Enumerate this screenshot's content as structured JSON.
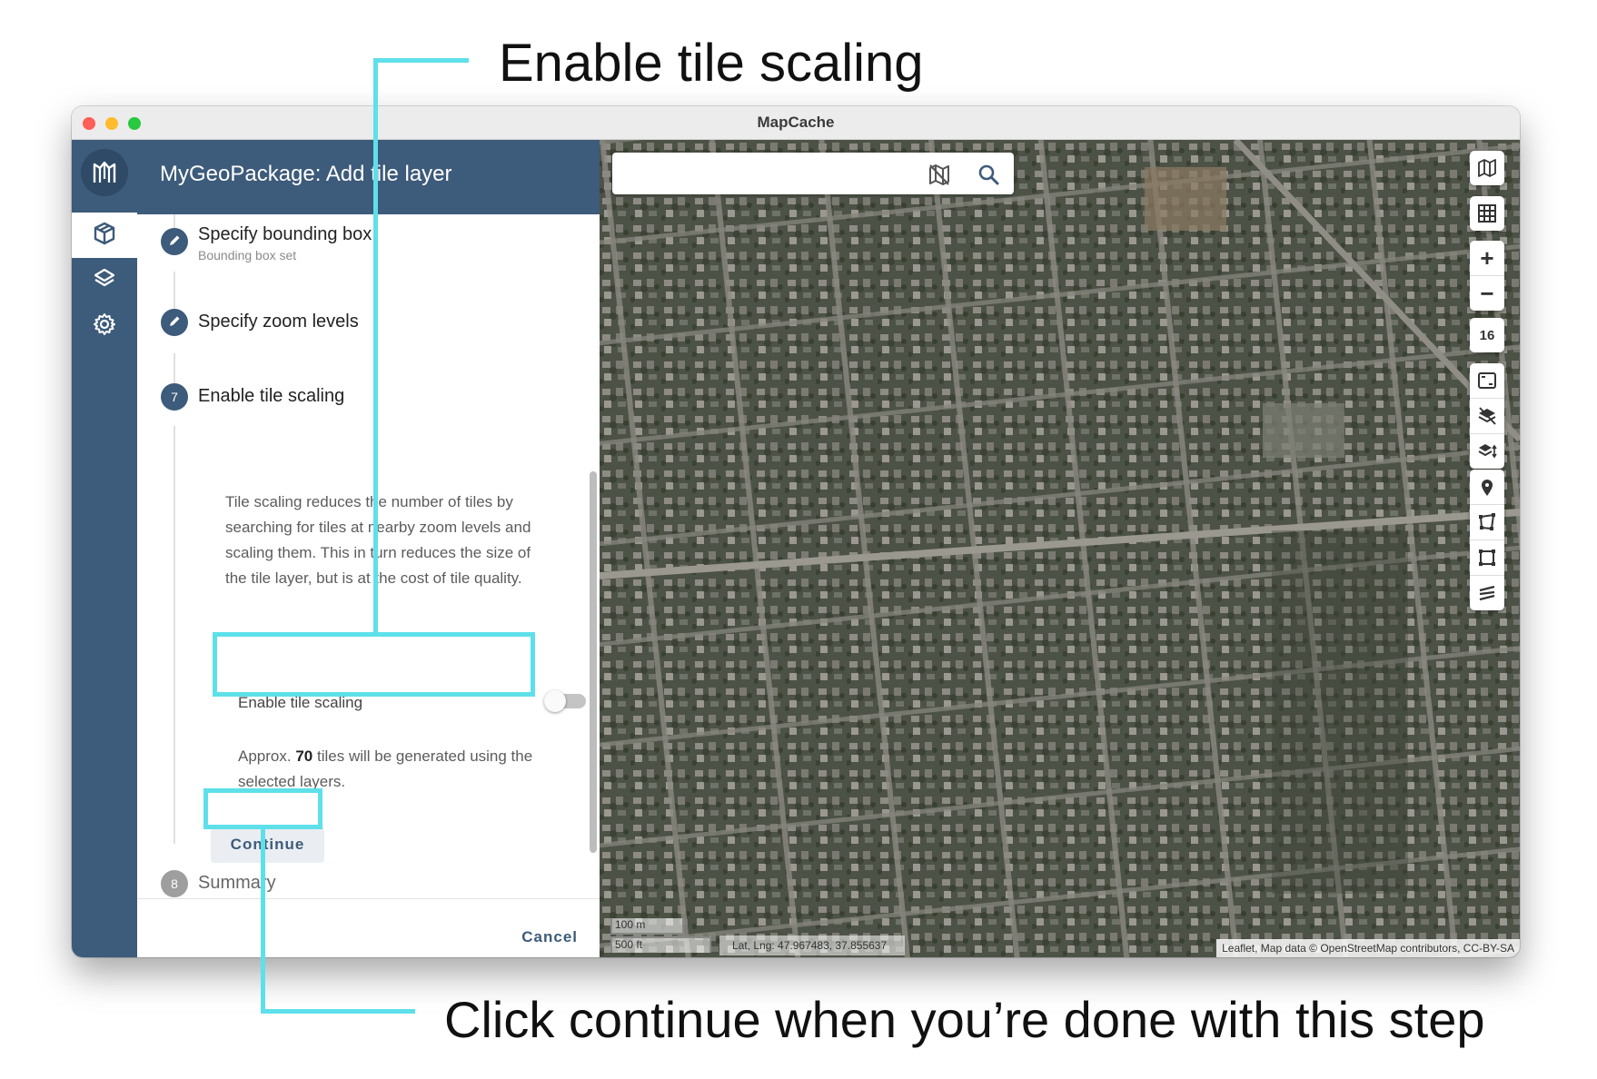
{
  "callouts": {
    "top": "Enable tile scaling",
    "bottom": "Click continue when you’re done with this step",
    "line_color": "#5ee0ea"
  },
  "window": {
    "title": "MapCache"
  },
  "rail": {
    "logo_icon": "mapcache-logo-icon",
    "items": [
      {
        "name": "geopackage",
        "icon": "cube-icon",
        "active": true
      },
      {
        "name": "layers",
        "icon": "layers-icon",
        "active": false
      },
      {
        "name": "settings",
        "icon": "gear-icon",
        "active": false
      }
    ]
  },
  "panel": {
    "title": "MyGeoPackage: Add tile layer",
    "steps": [
      {
        "number": "",
        "icon": "pencil-icon",
        "title": "Specify bounding box",
        "subtitle": "Bounding box set"
      },
      {
        "number": "",
        "icon": "pencil-icon",
        "title": "Specify zoom levels",
        "subtitle": ""
      },
      {
        "number": "7",
        "title": "Enable tile scaling",
        "subtitle": ""
      },
      {
        "number": "8",
        "title": "Summary",
        "subtitle": ""
      }
    ],
    "description": "Tile scaling reduces the number of tiles by searching for tiles at nearby zoom levels and scaling them. This in turn reduces the size of the tile layer, but is at the cost of tile quality.",
    "toggle": {
      "label": "Enable tile scaling",
      "enabled": false
    },
    "approx": {
      "prefix": "Approx.",
      "count": "70",
      "suffix": "tiles will be generated using the selected layers."
    },
    "continue_label": "Continue",
    "cancel_label": "Cancel"
  },
  "map": {
    "search_placeholder": "",
    "zoom_level": "16",
    "zoom_in": "+",
    "zoom_out": "−",
    "scale_metric": "100 m",
    "scale_imperial": "500 ft",
    "latlng": "Lat, Lng: 47.967483, 37.855637",
    "attribution": "Leaflet, Map data © OpenStreetMap contributors, CC-BY-SA",
    "controls": [
      "basemap-icon",
      "grid-icon",
      "zoom-in-icon",
      "zoom-out-icon",
      "zoom-level",
      "fit-bounds-icon",
      "clear-layers-icon",
      "layer-order-icon",
      "marker-icon",
      "polygon-icon",
      "rectangle-icon",
      "polyline-icon"
    ]
  },
  "colors": {
    "primary": "#3d5b7a",
    "accent": "#5ee0ea"
  }
}
